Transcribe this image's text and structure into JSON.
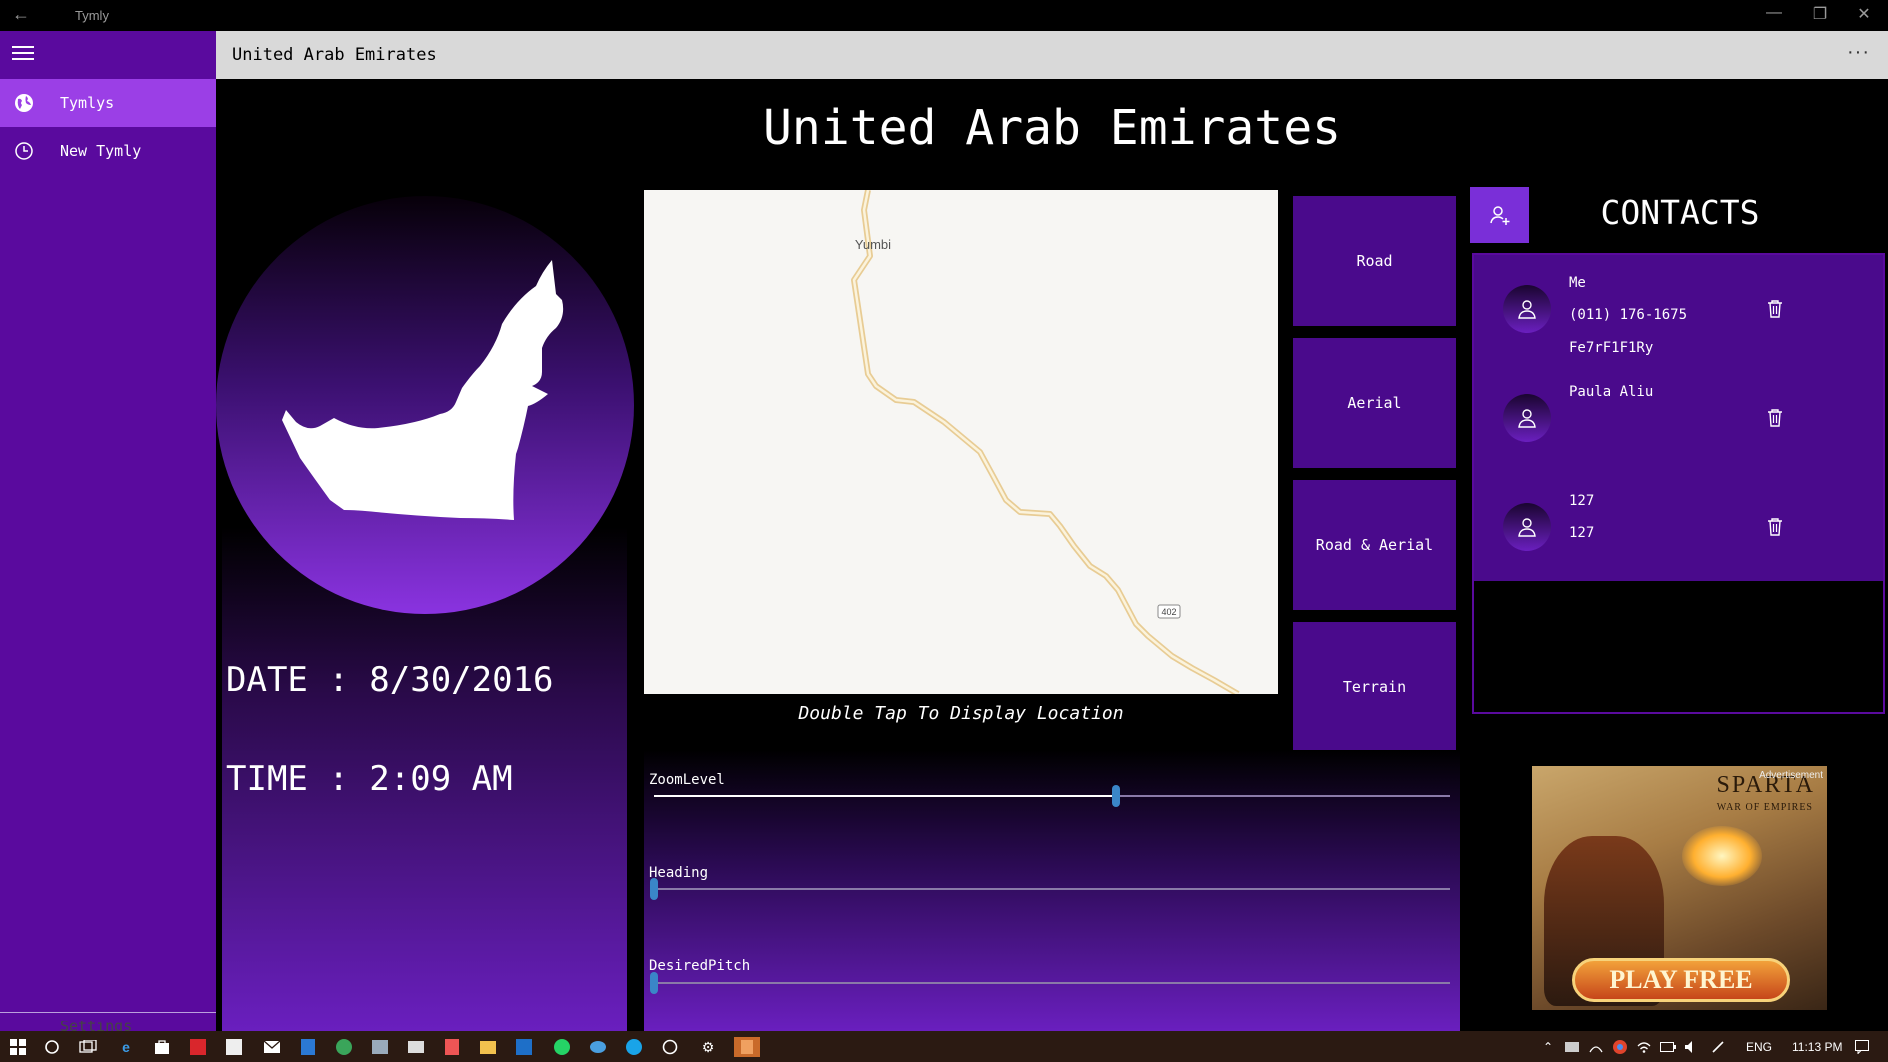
{
  "window": {
    "app_title": "Tymly",
    "back_icon": "back-arrow-icon"
  },
  "header": {
    "title": "United Arab Emirates",
    "more_label": "···"
  },
  "sidebar": {
    "items": [
      {
        "label": "Tymlys",
        "icon": "globe-icon",
        "active": true
      },
      {
        "label": "New Tymly",
        "icon": "clock-icon",
        "active": false
      }
    ],
    "settings_label": "Settings"
  },
  "main": {
    "page_title": "United Arab Emirates",
    "date_text": "DATE : 8/30/2016",
    "time_text": "TIME : 2:09 AM",
    "flag_shape": "uae-map-silhouette"
  },
  "map": {
    "place_label": "Yumbi",
    "road_shield": "402",
    "caption": "Double Tap To Display Location",
    "map_types": [
      "Road",
      "Aerial",
      "Road & Aerial",
      "Terrain"
    ]
  },
  "sliders": [
    {
      "label": "ZoomLevel",
      "fraction": 0.58
    },
    {
      "label": "Heading",
      "fraction": 0.0
    },
    {
      "label": "DesiredPitch",
      "fraction": 0.0
    }
  ],
  "contacts": {
    "title": "CONTACTS",
    "items": [
      {
        "lines": [
          "Me",
          "(011) 176-1675",
          "Fe7rF1F1Ry"
        ]
      },
      {
        "lines": [
          "Paula Aliu"
        ]
      },
      {
        "lines": [
          "127",
          "127"
        ]
      }
    ]
  },
  "ad": {
    "tag": "Advertisement",
    "brand": "SPARTA",
    "subtitle": "WAR OF EMPIRES",
    "cta": "PLAY FREE"
  },
  "taskbar": {
    "language": "ENG",
    "clock": "11:13 PM"
  },
  "colors": {
    "sidebar": "#5a0a9e",
    "sidebar_active": "#9b3fe6",
    "button_purple": "#4a0a8c",
    "slider_thumb": "#3a86c8"
  }
}
